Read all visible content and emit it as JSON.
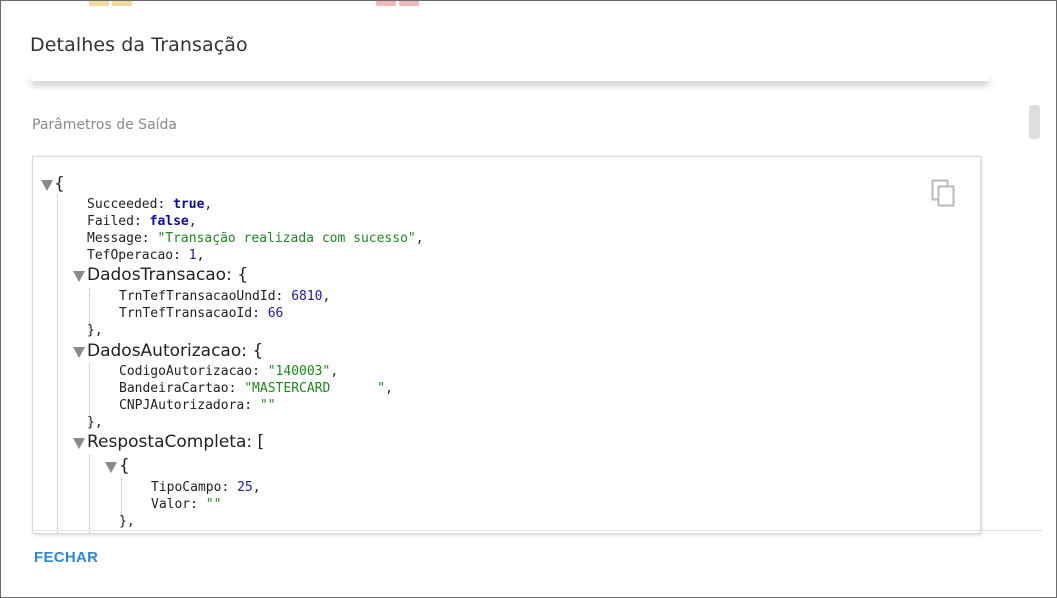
{
  "dialog": {
    "title": "Detalhes da Transação",
    "section_label": "Parâmetros de Saída",
    "close_label": "FECHAR"
  },
  "json": {
    "open_brace": "{",
    "succeeded_key": "Succeeded",
    "succeeded_val": "true",
    "failed_key": "Failed",
    "failed_val": "false",
    "message_key": "Message",
    "message_val": "\"Transação realizada com sucesso\"",
    "tefoperacao_key": "TefOperacao",
    "tefoperacao_val": "1",
    "dados_transacao_key": "DadosTransacao",
    "trn_und_key": "TrnTefTransacaoUndId",
    "trn_und_val": "6810",
    "trn_id_key": "TrnTefTransacaoId",
    "trn_id_val": "66",
    "dados_autorizacao_key": "DadosAutorizacao",
    "codigo_key": "CodigoAutorizacao",
    "codigo_val": "\"140003\"",
    "bandeira_key": "BandeiraCartao",
    "bandeira_val": "\"MASTERCARD      \"",
    "cnpj_key": "CNPJAutorizadora",
    "cnpj_val": "\"\"",
    "resposta_key": "RespostaCompleta",
    "tipo_key": "TipoCampo",
    "tipo_val": "25",
    "valor_key": "Valor",
    "valor_val": "\"\""
  },
  "icons": {
    "copy": "copy-icon",
    "collapse": "triangle-down-icon"
  },
  "colors": {
    "accent": "#2a8ad4",
    "string": "#1e8a1e",
    "number": "#1a1aa6",
    "boolean": "#0a0aa0"
  }
}
